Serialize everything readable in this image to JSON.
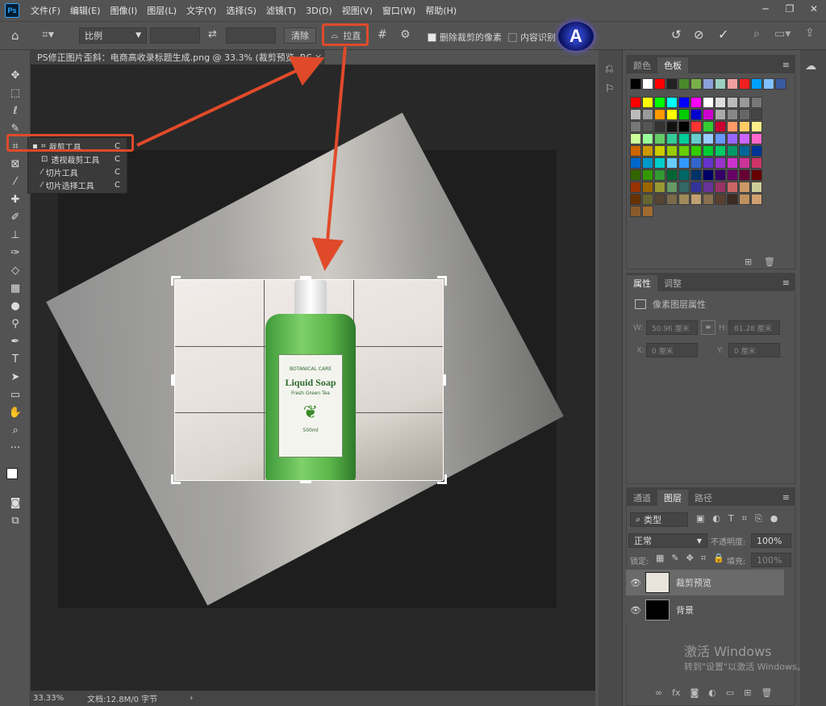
{
  "menu": [
    "文件(F)",
    "编辑(E)",
    "图像(I)",
    "图层(L)",
    "文字(Y)",
    "选择(S)",
    "滤镜(T)",
    "3D(D)",
    "视图(V)",
    "窗口(W)",
    "帮助(H)"
  ],
  "app_icon": "Ps",
  "options": {
    "ratio": "比例",
    "clear": "清除",
    "straighten": "拉直",
    "delete_pixels": "删除裁剪的像素",
    "content_aware": "内容识别"
  },
  "document": {
    "tab_title": "PS修正图片歪斜：电商高收录标题生成.png @ 33.3% (裁剪预览, RGB/8)",
    "zoom": "33.33%",
    "doc_info": "文档:12.8M/0 字节"
  },
  "flyout": [
    {
      "label": "裁剪工具",
      "key": "C"
    },
    {
      "label": "透视裁剪工具",
      "key": "C"
    },
    {
      "label": "切片工具",
      "key": "C"
    },
    {
      "label": "切片选择工具",
      "key": "C"
    }
  ],
  "product": {
    "brand": "BOTANICAL CARE",
    "name": "Liquid Soap",
    "sub": "Fresh Green Tea",
    "volume": "500ml"
  },
  "swatches_panel": {
    "tabs": [
      "颜色",
      "色板"
    ]
  },
  "properties_panel": {
    "tabs": [
      "属性",
      "调整"
    ],
    "title": "像素图层属性",
    "w_label": "W:",
    "w_value": "50.96 厘米",
    "h_label": "H:",
    "h_value": "81.28 厘米",
    "x_label": "X:",
    "x_value": "0 厘米",
    "y_label": "Y:",
    "y_value": "0 厘米"
  },
  "layers_panel": {
    "tabs": [
      "通道",
      "图层",
      "路径"
    ],
    "kind": "类型",
    "blend": "正常",
    "opacity_label": "不透明度:",
    "opacity": "100%",
    "lock_label": "锁定:",
    "fill_label": "填充:",
    "fill": "100%",
    "layers": [
      "裁剪预览",
      "背景"
    ]
  },
  "watermark": {
    "line1": "激活 Windows",
    "line2": "转到\"设置\"以激活 Windows。"
  },
  "colors": {
    "accent": "#e04a2a",
    "panel": "#535353",
    "dark": "#282828"
  }
}
